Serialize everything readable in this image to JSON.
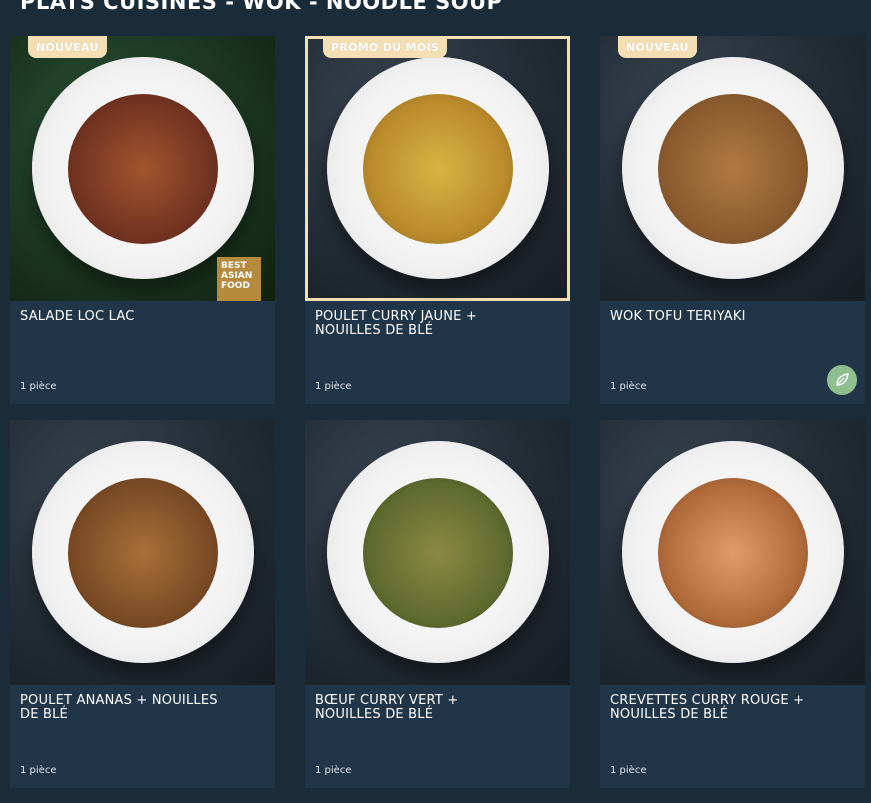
{
  "section": {
    "title": "PLATS CUISINÉS - WOK - NOODLE SOUP"
  },
  "products": [
    {
      "name": "SALADE LOC LAC",
      "qty": "1 pièce",
      "badge": "NOUVEAU",
      "award": "BEST ASIAN FOOD",
      "food_color": "#7a3b2a"
    },
    {
      "name": "POULET CURRY JAUNE + NOUILLES DE BLÉ",
      "qty": "1 pièce",
      "badge": "PROMO DU MOIS",
      "food_color": "#c9a13a"
    },
    {
      "name": "WOK TOFU TERIYAKI",
      "qty": "1 pièce",
      "badge": "NOUVEAU",
      "food_color": "#8a5a2e",
      "veg_icon": "leaf-icon"
    },
    {
      "name": "POULET ANANAS + NOUILLES DE BLÉ",
      "qty": "1 pièce",
      "food_color": "#8a5a2e"
    },
    {
      "name": "BŒUF CURRY VERT + NOUILLES DE BLÉ",
      "qty": "1 pièce",
      "food_color": "#6e6a3a"
    },
    {
      "name": "CREVETTES CURRY ROUGE + NOUILLES DE BLÉ",
      "qty": "1 pièce",
      "food_color": "#9a6a3a"
    }
  ],
  "colors": {
    "background": "#1a2b3a",
    "card": "#213548",
    "badge": "#f3dfb3",
    "veg": "#8fbf8f"
  }
}
